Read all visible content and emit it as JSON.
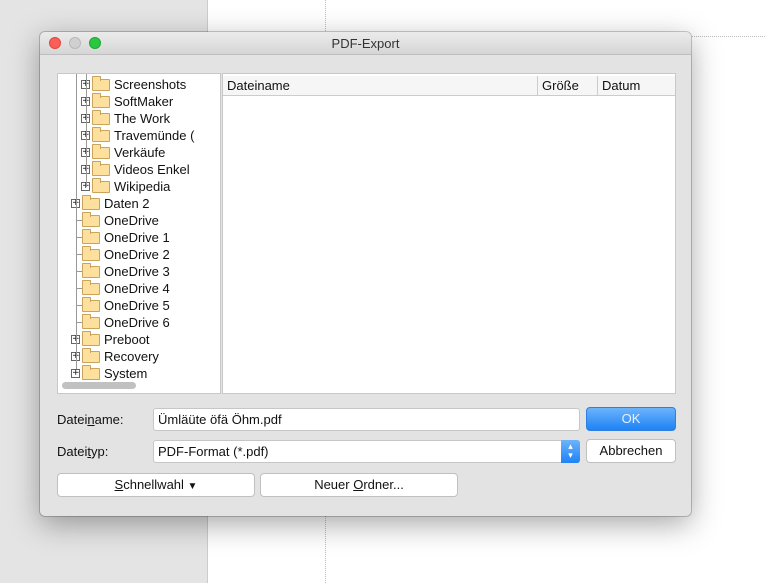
{
  "window": {
    "title": "PDF-Export"
  },
  "tree": {
    "items": [
      {
        "label": "Screenshots",
        "level": 2
      },
      {
        "label": "SoftMaker",
        "level": 2
      },
      {
        "label": "The Work",
        "level": 2
      },
      {
        "label": "Travemünde (",
        "level": 2
      },
      {
        "label": "Verkäufe",
        "level": 2
      },
      {
        "label": "Videos Enkel",
        "level": 2
      },
      {
        "label": "Wikipedia",
        "level": 2
      },
      {
        "label": "Daten 2",
        "level": 1,
        "expandable": true
      },
      {
        "label": "OneDrive",
        "level": 1
      },
      {
        "label": "OneDrive 1",
        "level": 1
      },
      {
        "label": "OneDrive 2",
        "level": 1
      },
      {
        "label": "OneDrive 3",
        "level": 1
      },
      {
        "label": "OneDrive 4",
        "level": 1
      },
      {
        "label": "OneDrive 5",
        "level": 1
      },
      {
        "label": "OneDrive 6",
        "level": 1
      },
      {
        "label": "Preboot",
        "level": 1,
        "expandable": true
      },
      {
        "label": "Recovery",
        "level": 1,
        "expandable": true
      },
      {
        "label": "System",
        "level": 1,
        "expandable": true
      }
    ]
  },
  "list": {
    "columns": [
      "Dateiname",
      "Größe",
      "Datum"
    ]
  },
  "form": {
    "filename_label_pre": "Datei",
    "filename_label_u": "n",
    "filename_label_post": "ame:",
    "filename_value": "Ümläüte öfä Öhm.pdf",
    "filetype_label_pre": "Datei",
    "filetype_label_u": "t",
    "filetype_label_post": "yp:",
    "filetype_value": "PDF-Format (*.pdf)"
  },
  "buttons": {
    "ok": "OK",
    "cancel": "Abbrechen",
    "quick_u": "S",
    "quick_rest": "chnellwahl",
    "quick_arrow": "▼",
    "newfolder_pre": "Neuer ",
    "newfolder_u": "O",
    "newfolder_post": "rdner..."
  },
  "colors": {
    "accent": "#1e82f6",
    "folder": "#fddf9e"
  }
}
